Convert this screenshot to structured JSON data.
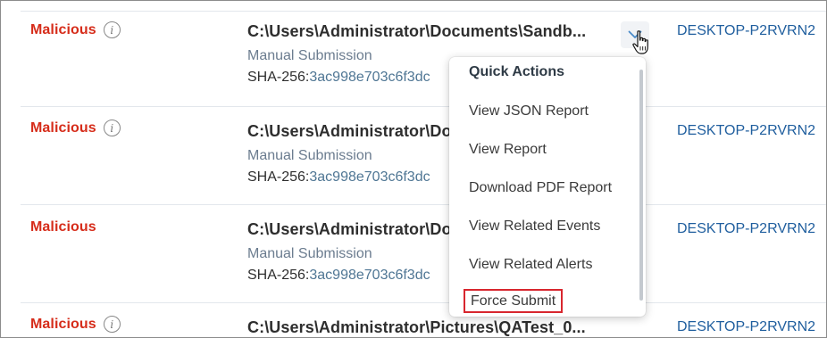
{
  "rows": [
    {
      "verdict": "Malicious",
      "path": "C:\\Users\\Administrator\\Documents\\Sandb...",
      "source": "Manual Submission",
      "hash_label": "SHA-256:",
      "hash_value": "3ac998e703c6f3dc",
      "host": "DESKTOP-P2RVRN2"
    },
    {
      "verdict": "Malicious",
      "path": "C:\\Users\\Administrator\\Documents",
      "source": "Manual Submission",
      "hash_label": "SHA-256:",
      "hash_value": "3ac998e703c6f3dc",
      "host": "DESKTOP-P2RVRN2"
    },
    {
      "verdict": "Malicious",
      "path": "C:\\Users\\Administrator\\Documents",
      "source": "Manual Submission",
      "hash_label": "SHA-256:",
      "hash_value": "3ac998e703c6f3dc",
      "host": "DESKTOP-P2RVRN2"
    },
    {
      "verdict": "Malicious",
      "path": "C:\\Users\\Administrator\\Pictures\\QATest_0...",
      "host": "DESKTOP-P2RVRN2"
    }
  ],
  "quick_actions": {
    "header": "Quick Actions",
    "items": [
      "View JSON Report",
      "View Report",
      "Download PDF Report",
      "View Related Events",
      "View Related Alerts",
      "Force Submit"
    ]
  },
  "icons": {
    "info": "info-circle-icon",
    "chevron": "chevron-down-icon",
    "cursor": "hand-pointer-cursor-icon"
  },
  "colors": {
    "verdict": "#d62c1a",
    "host_link": "#1f5e9e",
    "highlight_border": "#d8262e"
  }
}
